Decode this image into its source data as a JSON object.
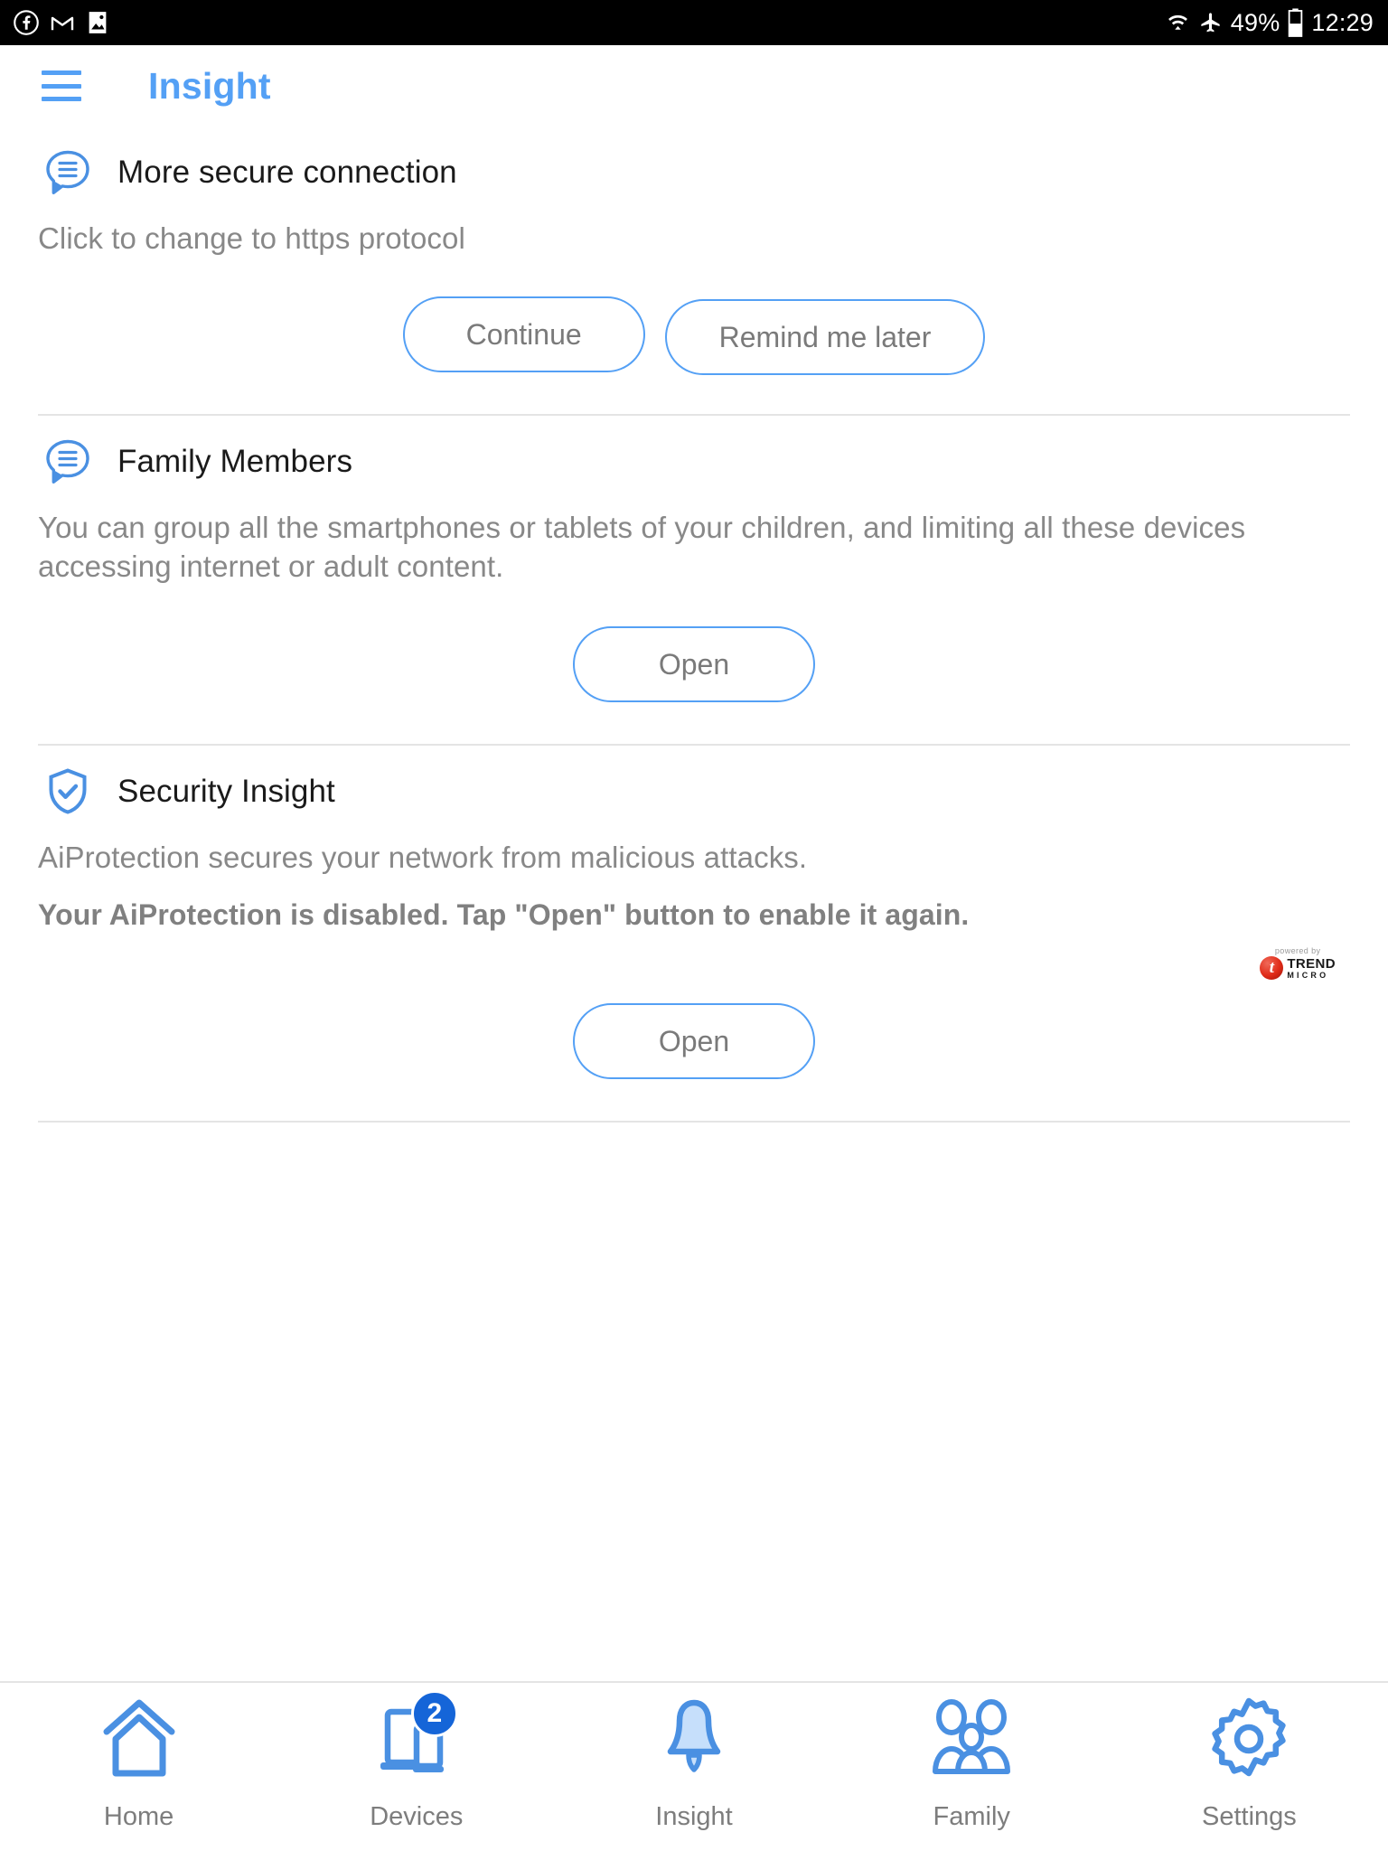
{
  "status_bar": {
    "left_icons": [
      "facebook-icon",
      "gmail-icon",
      "photo-icon"
    ],
    "wifi_icon": "wifi-icon",
    "airplane_icon": "airplane-mode-icon",
    "battery_percent": "49%",
    "battery_icon": "battery-icon",
    "time": "12:29"
  },
  "app_bar": {
    "menu_icon": "hamburger-menu-icon",
    "title": "Insight"
  },
  "cards": [
    {
      "icon": "speech-bubble-lines-icon",
      "title": "More secure connection",
      "description": "Click to change to https protocol",
      "buttons": [
        "Continue",
        "Remind me later"
      ]
    },
    {
      "icon": "speech-bubble-lines-icon",
      "title": "Family Members",
      "description": "You can group all the smartphones or tablets of your children, and limiting all these devices accessing internet or adult content.",
      "buttons": [
        "Open"
      ]
    },
    {
      "icon": "shield-check-icon",
      "title": "Security Insight",
      "description": "AiProtection secures your network from malicious attacks.",
      "warning": "Your AiProtection is disabled. Tap \"Open\" button to enable it again.",
      "badge": {
        "powered_by": "powered by",
        "brand_line1": "TREND",
        "brand_line2": "MICRO"
      },
      "buttons": [
        "Open"
      ]
    }
  ],
  "bottom_nav": {
    "items": [
      {
        "icon": "home-icon",
        "label": "Home",
        "active": false,
        "badge": ""
      },
      {
        "icon": "devices-icon",
        "label": "Devices",
        "active": false,
        "badge": "2"
      },
      {
        "icon": "bell-icon",
        "label": "Insight",
        "active": true,
        "badge": ""
      },
      {
        "icon": "family-people-icon",
        "label": "Family",
        "active": false,
        "badge": ""
      },
      {
        "icon": "gear-icon",
        "label": "Settings",
        "active": false,
        "badge": ""
      }
    ]
  },
  "colors": {
    "accent_blue": "#54a0f5",
    "nav_blue": "#4a90e2",
    "badge_blue": "#1565d8",
    "text_dark": "#1a1a1a",
    "text_gray": "#888888",
    "divider": "#e4e4e4",
    "status_bar_bg": "#000000"
  }
}
